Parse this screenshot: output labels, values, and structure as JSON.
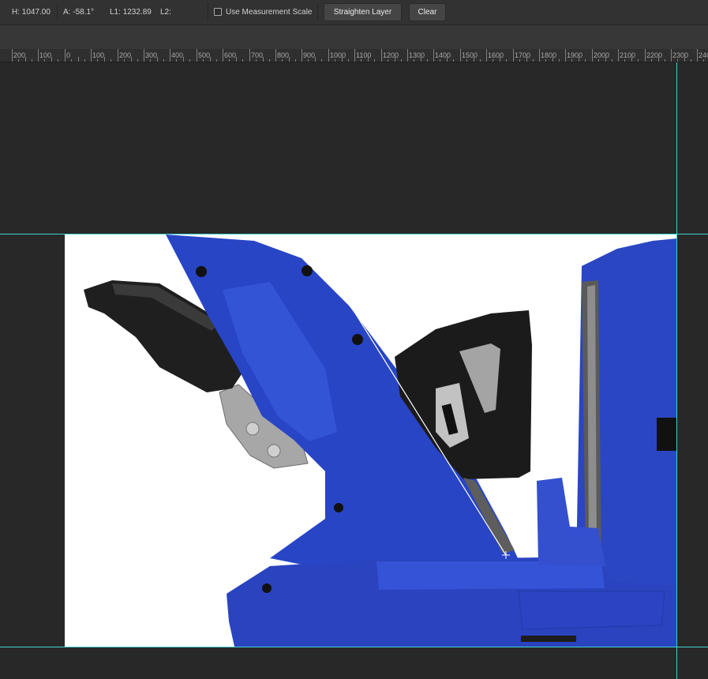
{
  "options_bar": {
    "h_label": "H:",
    "h_value": "1047.00",
    "a_label": "A:",
    "a_value": "-58.1°",
    "l1_label": "L1:",
    "l1_value": "1232.89",
    "l2_label": "L2:",
    "l2_value": "",
    "measurement_scale_label": "Use Measurement Scale",
    "measurement_scale_checked": false,
    "straighten_label": "Straighten Layer",
    "clear_label": "Clear"
  },
  "ruler": {
    "labels": [
      "200",
      "100",
      "0",
      "100",
      "200",
      "300",
      "400",
      "500",
      "600",
      "700",
      "800",
      "900",
      "1000",
      "1100",
      "1200",
      "1300",
      "1400",
      "1500",
      "1600",
      "1700",
      "1800",
      "1900",
      "2000",
      "2100",
      "2200",
      "2300",
      "240"
    ]
  },
  "colors": {
    "ui_background": "#282828",
    "guide": "#3fd2d2",
    "tool_blue": "#2a44c4",
    "tool_black": "#1c1c1c",
    "measure_line": "#ffffff"
  },
  "icons": {
    "crosshair_start": "crosshair-icon",
    "crosshair_end": "crosshair-icon"
  }
}
